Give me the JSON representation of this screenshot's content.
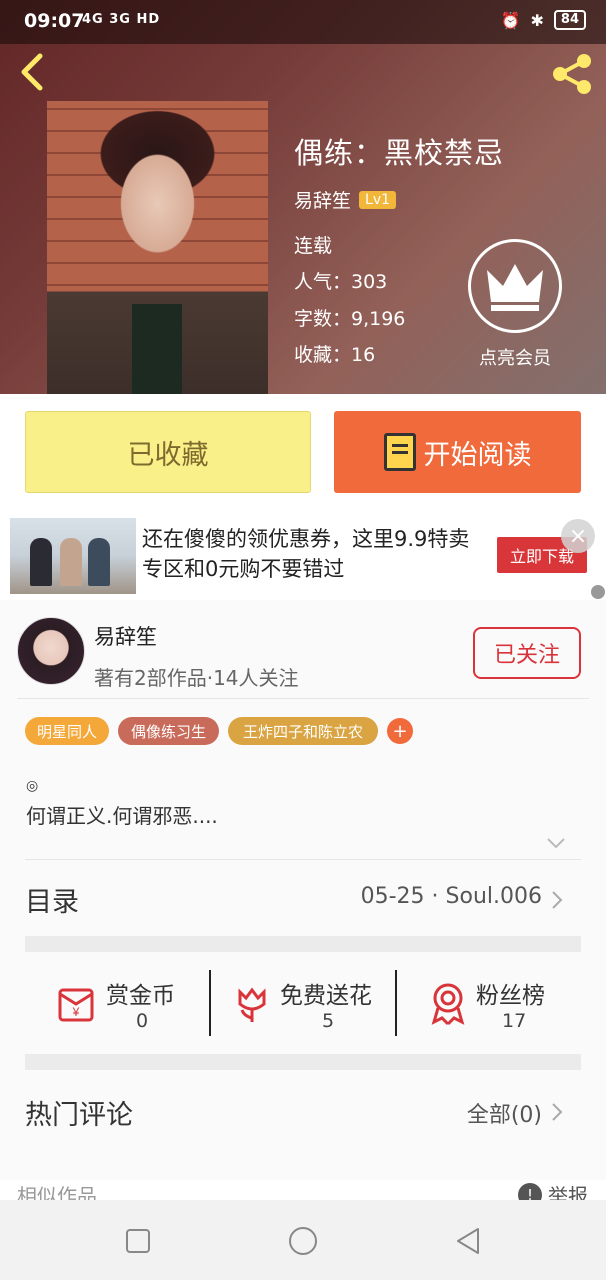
{
  "status_bar": {
    "time": "09:07",
    "network": "4G 3G HD",
    "battery": "84"
  },
  "book": {
    "title": "偶练：黑校禁忌",
    "author": "易辞笙",
    "level": "Lv1",
    "status": "连载",
    "popularity": "人气：303",
    "word_count": "字数：9,196",
    "favorites": "收藏：16"
  },
  "vip": {
    "label": "点亮会员",
    "icon": "crown-icon"
  },
  "actions": {
    "collected_label": "已收藏",
    "read_label": "开始阅读"
  },
  "ad": {
    "text": "还在傻傻的领优惠券，这里9.9特卖专区和0元购不要错过",
    "button": "立即下载",
    "close": "×"
  },
  "author_card": {
    "name": "易辞笙",
    "stats": "著有2部作品·14人关注",
    "follow_label": "已关注"
  },
  "tags": [
    {
      "label": "明星同人",
      "color": "#f4a83a"
    },
    {
      "label": "偶像练习生",
      "color": "#c96b5a"
    },
    {
      "label": "王炸四子和陈立农",
      "color": "#d9a441"
    }
  ],
  "tag_add": "+",
  "intro": {
    "symbol": "◎",
    "text": "何谓正义.何谓邪恶...."
  },
  "toc": {
    "title": "目录",
    "latest": "05-25 · Soul.006"
  },
  "stats": [
    {
      "label": "赏金币",
      "value": "0",
      "icon": "red-envelope-icon"
    },
    {
      "label": "免费送花",
      "value": "5",
      "icon": "flower-icon"
    },
    {
      "label": "粉丝榜",
      "value": "17",
      "icon": "medal-icon"
    }
  ],
  "comments": {
    "title": "热门评论",
    "all": "全部(0)"
  },
  "footer": {
    "similar": "相似作品",
    "report": "举报"
  },
  "colors": {
    "accent": "#f06a3c",
    "red": "#d8343a",
    "collected_bg": "#faf08a"
  }
}
